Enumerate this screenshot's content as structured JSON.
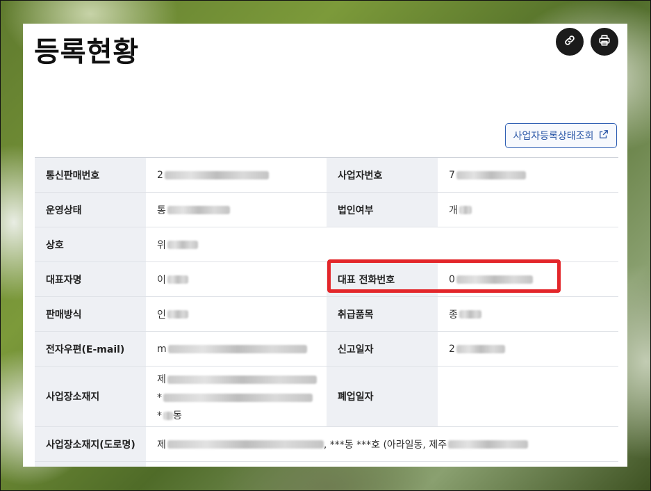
{
  "page": {
    "title": "등록현황",
    "lookup_button": "사업자등록상태조회"
  },
  "icons": {
    "link": "link-icon",
    "print": "print-icon",
    "external": "external-link-icon"
  },
  "colors": {
    "highlight": "#e3262a",
    "accent": "#2a56a6",
    "header_bg": "#eef0f4"
  },
  "table": {
    "business_report_no_label": "통신판매번호",
    "business_report_no_prefix": "2",
    "business_no_label": "사업자번호",
    "business_no_prefix": "7",
    "status_label": "운영상태",
    "status_prefix": "통",
    "corp_label": "법인여부",
    "corp_prefix": "개",
    "company_label": "상호",
    "company_prefix": "위",
    "ceo_label": "대표자명",
    "ceo_prefix": "이",
    "phone_label": "대표 전화번호",
    "phone_prefix": "0",
    "sales_label": "판매방식",
    "sales_prefix": "인",
    "items_label": "취급품목",
    "items_prefix": "종",
    "email_label": "전자우편(E-mail)",
    "email_prefix": "m",
    "report_date_label": "신고일자",
    "report_date_prefix": "2",
    "address_label": "사업장소재지",
    "address_line1_prefix": "제",
    "address_line2_prefix": "*",
    "address_line3_prefix": "*",
    "address_line3_suffix": "동",
    "closed_label": "폐업일자",
    "road_address_label": "사업장소재지(도로명)",
    "road_address_prefix": "제",
    "road_address_visible": ", ***동 ***호 (아라일동, 제주"
  }
}
